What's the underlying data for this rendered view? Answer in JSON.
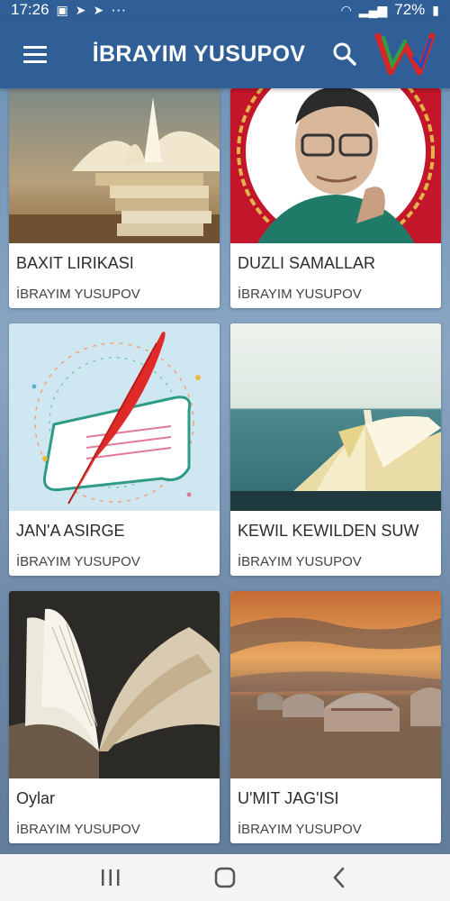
{
  "status_bar": {
    "time": "17:26",
    "more": "···",
    "battery": "72%"
  },
  "app_bar": {
    "title": "İBRAYIM YUSUPOV",
    "menu_icon": "hamburger-menu-icon",
    "search_icon": "search-icon",
    "logo_letter": "W"
  },
  "books": [
    {
      "title": "BAXIT LIRIKASI",
      "author": "İBRAYIM YUSUPOV",
      "image": "stacked-open-books"
    },
    {
      "title": "DUZLI SAMALLAR",
      "author": "İBRAYIM YUSUPOV",
      "image": "author-portrait"
    },
    {
      "title": "JAN'A ASIRGE",
      "author": "İBRAYIM YUSUPOV",
      "image": "quill-and-scroll"
    },
    {
      "title": "KEWIL KEWILDEN SUW",
      "author": "İBRAYIM YUSUPOV",
      "image": "open-book-by-sea"
    },
    {
      "title": "Oylar",
      "author": "İBRAYIM YUSUPOV",
      "image": "open-book-closeup"
    },
    {
      "title": "U'MIT JAG'ISI",
      "author": "İBRAYIM YUSUPOV",
      "image": "yurts-at-sunset"
    }
  ],
  "colors": {
    "app_bar": "#2f5f96",
    "card_bg": "#ffffff",
    "logo_red": "#d62828",
    "logo_green": "#2ea043"
  },
  "nav_bar": {
    "recents_icon": "recents-icon",
    "home_icon": "home-icon",
    "back_icon": "back-icon"
  }
}
